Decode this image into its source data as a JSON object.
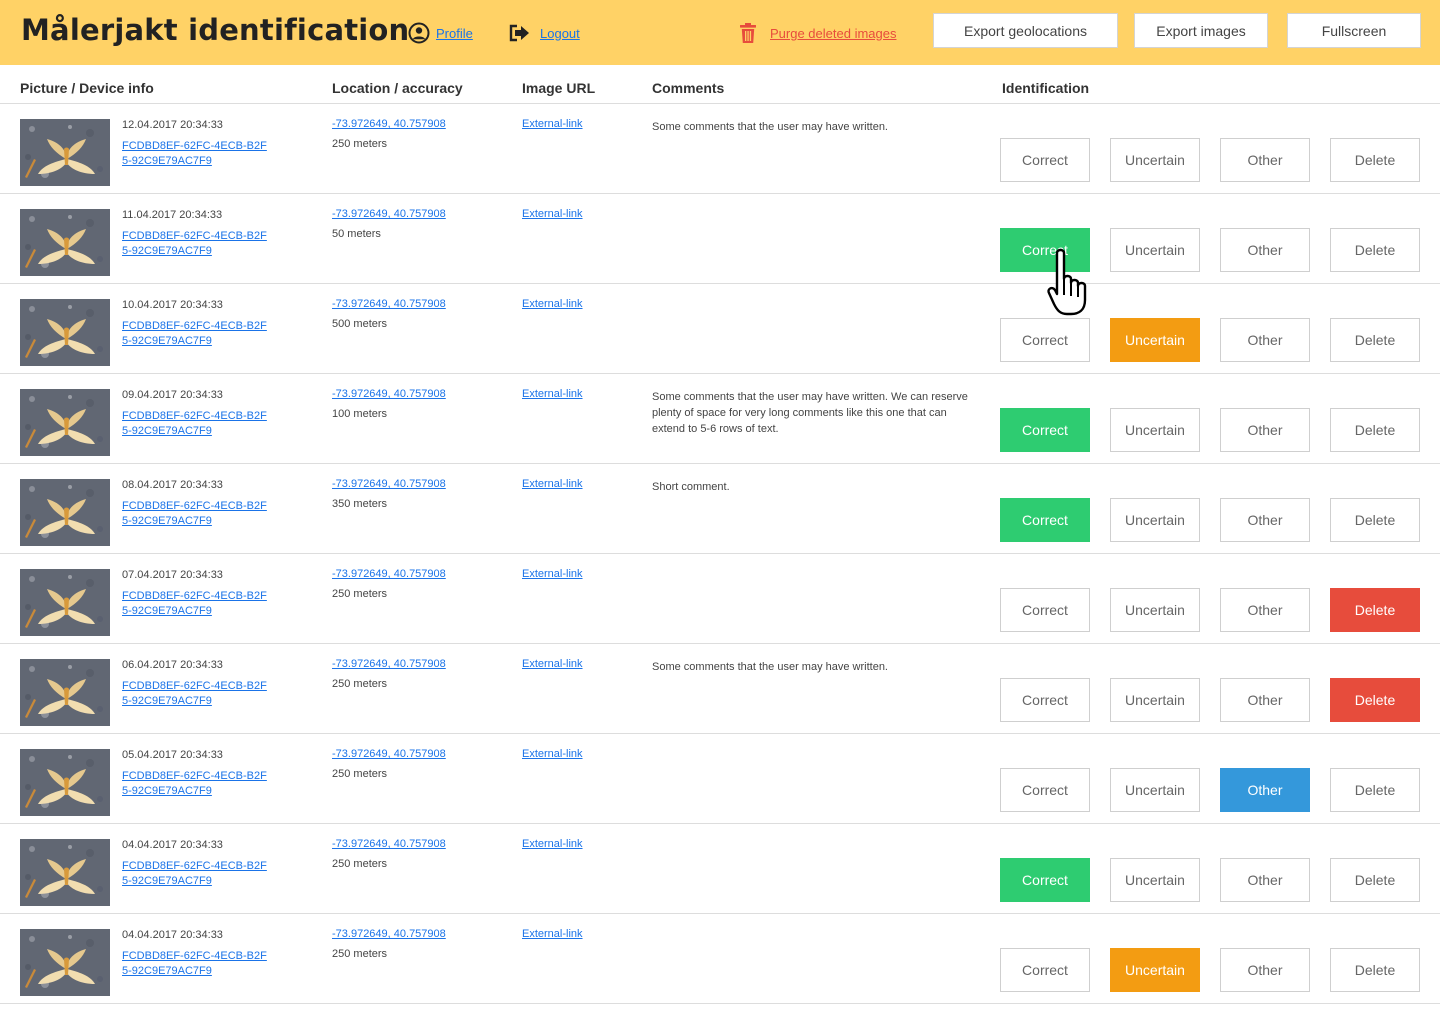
{
  "header": {
    "title": "Målerjakt identification",
    "profile_label": "Profile",
    "logout_label": "Logout",
    "purge_label": "Purge deleted images",
    "export_geo_label": "Export geolocations",
    "export_images_label": "Export images",
    "fullscreen_label": "Fullscreen",
    "colors": {
      "background": "#ffd266",
      "link": "#1a73e8",
      "danger": "#e74c3c"
    }
  },
  "columns": [
    "Picture / Device info",
    "Location / accuracy",
    "Image URL",
    "Comments",
    "Identification"
  ],
  "buttons": {
    "correct": "Correct",
    "uncertain": "Uncertain",
    "other": "Other",
    "delete": "Delete"
  },
  "status_colors": {
    "correct": "#2ecc71",
    "uncertain": "#f39c12",
    "other": "#3498db",
    "delete": "#e74c3c"
  },
  "rows": [
    {
      "date": "12.04.2017 20:34:33",
      "device": "FCDBD8EF-62FC-4ECB-B2F5-92C9E79AC7F9",
      "location": "-73.972649, 40.757908",
      "accuracy": "250 meters",
      "url": "External-link",
      "comment": "Some comments that the user may have written.",
      "selected": ""
    },
    {
      "date": "11.04.2017 20:34:33",
      "device": "FCDBD8EF-62FC-4ECB-B2F5-92C9E79AC7F9",
      "location": "-73.972649, 40.757908",
      "accuracy": "50 meters",
      "url": "External-link",
      "comment": "",
      "selected": "correct"
    },
    {
      "date": "10.04.2017 20:34:33",
      "device": "FCDBD8EF-62FC-4ECB-B2F5-92C9E79AC7F9",
      "location": "-73.972649, 40.757908",
      "accuracy": "500 meters",
      "url": "External-link",
      "comment": "",
      "selected": "uncertain"
    },
    {
      "date": "09.04.2017 20:34:33",
      "device": "FCDBD8EF-62FC-4ECB-B2F5-92C9E79AC7F9",
      "location": "-73.972649, 40.757908",
      "accuracy": "100 meters",
      "url": "External-link",
      "comment": "Some comments that the user may have written. We can reserve plenty of space for very long comments like this one that can extend to 5-6 rows of text.",
      "selected": "correct"
    },
    {
      "date": "08.04.2017 20:34:33",
      "device": "FCDBD8EF-62FC-4ECB-B2F5-92C9E79AC7F9",
      "location": "-73.972649, 40.757908",
      "accuracy": "350 meters",
      "url": "External-link",
      "comment": "Short comment.",
      "selected": "correct"
    },
    {
      "date": "07.04.2017 20:34:33",
      "device": "FCDBD8EF-62FC-4ECB-B2F5-92C9E79AC7F9",
      "location": "-73.972649, 40.757908",
      "accuracy": "250 meters",
      "url": "External-link",
      "comment": "",
      "selected": "delete"
    },
    {
      "date": "06.04.2017 20:34:33",
      "device": "FCDBD8EF-62FC-4ECB-B2F5-92C9E79AC7F9",
      "location": "-73.972649, 40.757908",
      "accuracy": "250 meters",
      "url": "External-link",
      "comment": "Some comments that the user may have written.",
      "selected": "delete"
    },
    {
      "date": "05.04.2017 20:34:33",
      "device": "FCDBD8EF-62FC-4ECB-B2F5-92C9E79AC7F9",
      "location": "-73.972649, 40.757908",
      "accuracy": "250 meters",
      "url": "External-link",
      "comment": "",
      "selected": "other"
    },
    {
      "date": "04.04.2017 20:34:33",
      "device": "FCDBD8EF-62FC-4ECB-B2F5-92C9E79AC7F9",
      "location": "-73.972649, 40.757908",
      "accuracy": "250 meters",
      "url": "External-link",
      "comment": "",
      "selected": "correct"
    },
    {
      "date": "04.04.2017 20:34:33",
      "device": "FCDBD8EF-62FC-4ECB-B2F5-92C9E79AC7F9",
      "location": "-73.972649, 40.757908",
      "accuracy": "250 meters",
      "url": "External-link",
      "comment": "",
      "selected": "uncertain"
    }
  ]
}
